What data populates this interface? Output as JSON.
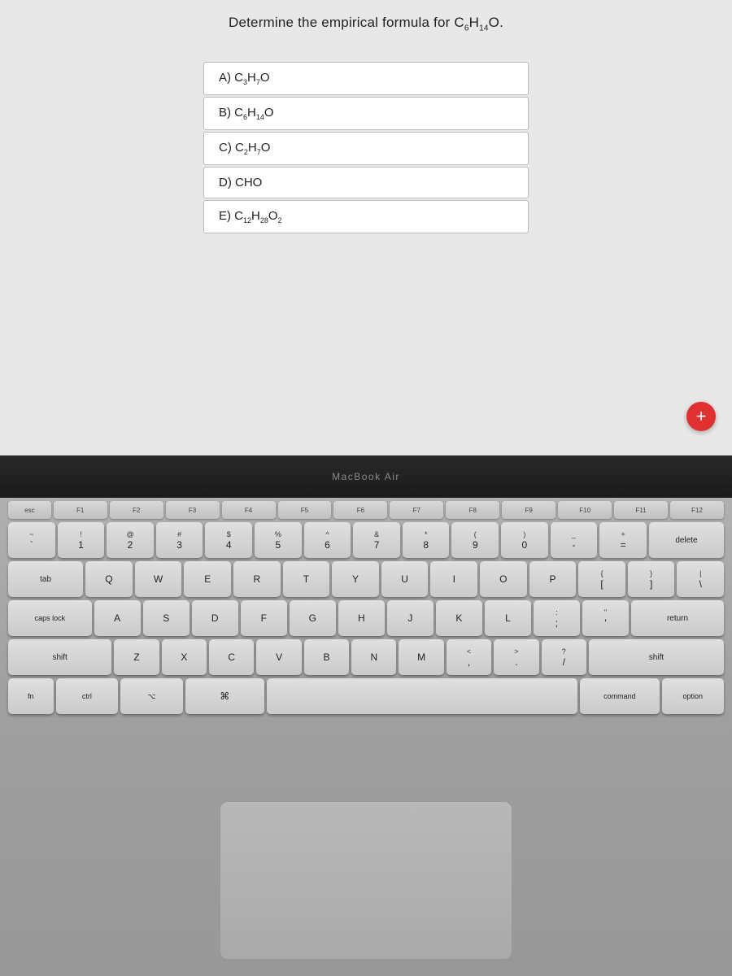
{
  "screen": {
    "question": "Determine the empirical formula for C₆H₁₄O.",
    "question_plain": "Determine the empirical formula for C",
    "question_sub1": "6",
    "question_mid": "H",
    "question_sub2": "14",
    "question_end": "O.",
    "plus_button": "+"
  },
  "answers": [
    {
      "id": "A",
      "label": "A) C",
      "sub1": "3",
      "mid": "H",
      "sub2": "7",
      "end": "O"
    },
    {
      "id": "B",
      "label": "B) C",
      "sub1": "6",
      "mid": "H",
      "sub2": "14",
      "end": "O"
    },
    {
      "id": "C",
      "label": "C) C",
      "sub1": "2",
      "mid": "H",
      "sub2": "7",
      "end": "O"
    },
    {
      "id": "D",
      "label": "D) CHO",
      "sub1": "",
      "mid": "",
      "sub2": "",
      "end": ""
    },
    {
      "id": "E",
      "label": "E) C",
      "sub1": "12",
      "mid": "H",
      "sub2": "28",
      "end": "O₂"
    }
  ],
  "macbook_label": "MacBook Air",
  "keyboard": {
    "fn_row": [
      "esc",
      "F1",
      "F2",
      "F3",
      "F4",
      "F5",
      "F6",
      "F7",
      "F8",
      "F9",
      "F10",
      "F11",
      "F12"
    ],
    "num_row": [
      "`~",
      "1!",
      "2@",
      "3#",
      "4$",
      "5%",
      "6^",
      "7&",
      "8*",
      "9(",
      "0)",
      "-_",
      "=+",
      "delete"
    ],
    "row2": [
      "tab",
      "Q",
      "W",
      "E",
      "R",
      "T",
      "Y",
      "U",
      "I",
      "O",
      "P",
      "[{",
      "]}",
      "\\|"
    ],
    "row3": [
      "caps",
      "A",
      "S",
      "D",
      "F",
      "G",
      "H",
      "J",
      "K",
      "L",
      ";:",
      "'\"",
      "return"
    ],
    "row4": [
      "shift",
      "Z",
      "X",
      "C",
      "V",
      "B",
      "N",
      "M",
      ",<",
      ".>",
      "/?",
      "shift"
    ],
    "bottom": [
      "fn",
      "ctrl",
      "opt",
      "cmd",
      "space",
      "cmd",
      "opt"
    ]
  }
}
